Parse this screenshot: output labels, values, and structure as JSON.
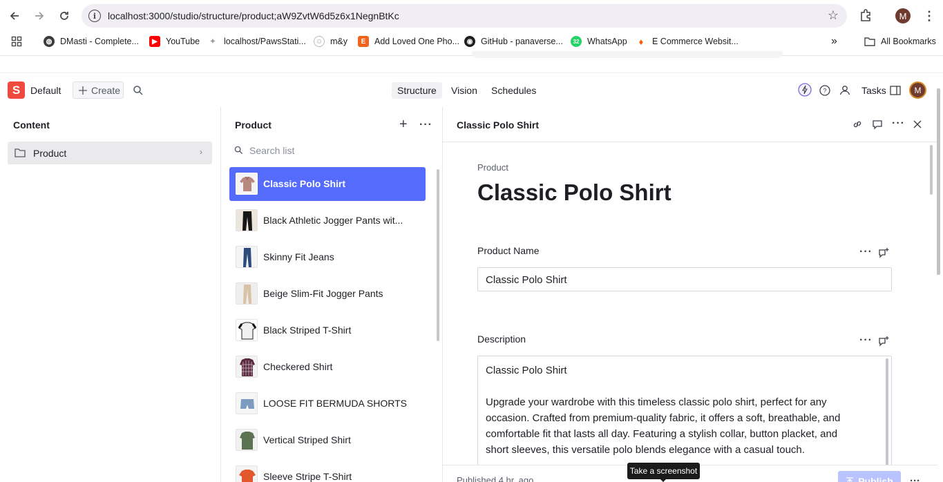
{
  "browser": {
    "url": "localhost:3000/studio/structure/product;aW9ZvtW6d5z6x1NegnBtKc",
    "profile_initial": "M",
    "bookmarks": [
      {
        "label": "DMasti - Complete...",
        "icon": "globe-icon",
        "color": "#3c3c3c"
      },
      {
        "label": "YouTube",
        "icon": "youtube-icon",
        "color": "#ff0000"
      },
      {
        "label": "localhost/PawsStati...",
        "icon": "paw-icon",
        "color": "#9a9a9a"
      },
      {
        "label": "m&y",
        "icon": "smile-icon",
        "color": "#9a9a9a"
      },
      {
        "label": "Add Loved One Pho...",
        "icon": "etsy-icon",
        "color": "#f1641e"
      },
      {
        "label": "GitHub - panaverse...",
        "icon": "github-icon",
        "color": "#1f1f1f"
      },
      {
        "label": "WhatsApp",
        "icon": "whatsapp-icon",
        "color": "#25d366"
      },
      {
        "label": "E Commerce Websit...",
        "icon": "fire-icon",
        "color": "#ff5a00"
      }
    ],
    "more_bookmarks": "»",
    "all_bookmarks": "All Bookmarks"
  },
  "studio": {
    "logo_letter": "S",
    "workspace": "Default",
    "create_label": "Create",
    "tools": [
      {
        "label": "Structure",
        "active": true
      },
      {
        "label": "Vision",
        "active": false
      },
      {
        "label": "Schedules",
        "active": false
      }
    ],
    "tasks_label": "Tasks",
    "user_initial": "M",
    "brand_color": "#ef4a3d",
    "accent_color": "#556bfc"
  },
  "content_pane": {
    "title": "Content",
    "items": [
      {
        "label": "Product",
        "chevron": "›"
      }
    ]
  },
  "list_pane": {
    "title": "Product",
    "search_placeholder": "Search list",
    "items": [
      {
        "title": "Classic Polo Shirt",
        "thumb": "polo-shirt",
        "selected": true
      },
      {
        "title": "Black Athletic Jogger Pants wit...",
        "thumb": "black-pants",
        "selected": false
      },
      {
        "title": "Skinny Fit Jeans",
        "thumb": "jeans",
        "selected": false
      },
      {
        "title": "Beige Slim-Fit Jogger Pants",
        "thumb": "beige-pants",
        "selected": false
      },
      {
        "title": "Black Striped T-Shirt",
        "thumb": "striped-tshirt",
        "selected": false
      },
      {
        "title": "Checkered Shirt",
        "thumb": "checkered-shirt",
        "selected": false
      },
      {
        "title": "LOOSE FIT BERMUDA SHORTS",
        "thumb": "shorts",
        "selected": false
      },
      {
        "title": "Vertical Striped Shirt",
        "thumb": "green-shirt",
        "selected": false
      },
      {
        "title": "Sleeve Stripe T-Shirt",
        "thumb": "orange-tshirt",
        "selected": false
      }
    ]
  },
  "document": {
    "header_title": "Classic Polo Shirt",
    "type_label": "Product",
    "heading": "Classic Polo Shirt",
    "fields": {
      "name_label": "Product Name",
      "name_value": "Classic Polo Shirt",
      "description_label": "Description",
      "description_first_line": "Classic Polo Shirt",
      "description_lines": [
        "Upgrade your wardrobe with this timeless classic polo shirt, perfect for any",
        "occasion. Crafted from premium-quality fabric, it offers a soft, breathable, and",
        "comfortable fit that lasts all day. Featuring a stylish collar, button placket, and",
        "short sleeves, this versatile polo blends elegance with a casual touch."
      ]
    },
    "status": "Published 4 hr. ago",
    "publish_label": "Publish"
  },
  "tooltip": "Take a screenshot"
}
